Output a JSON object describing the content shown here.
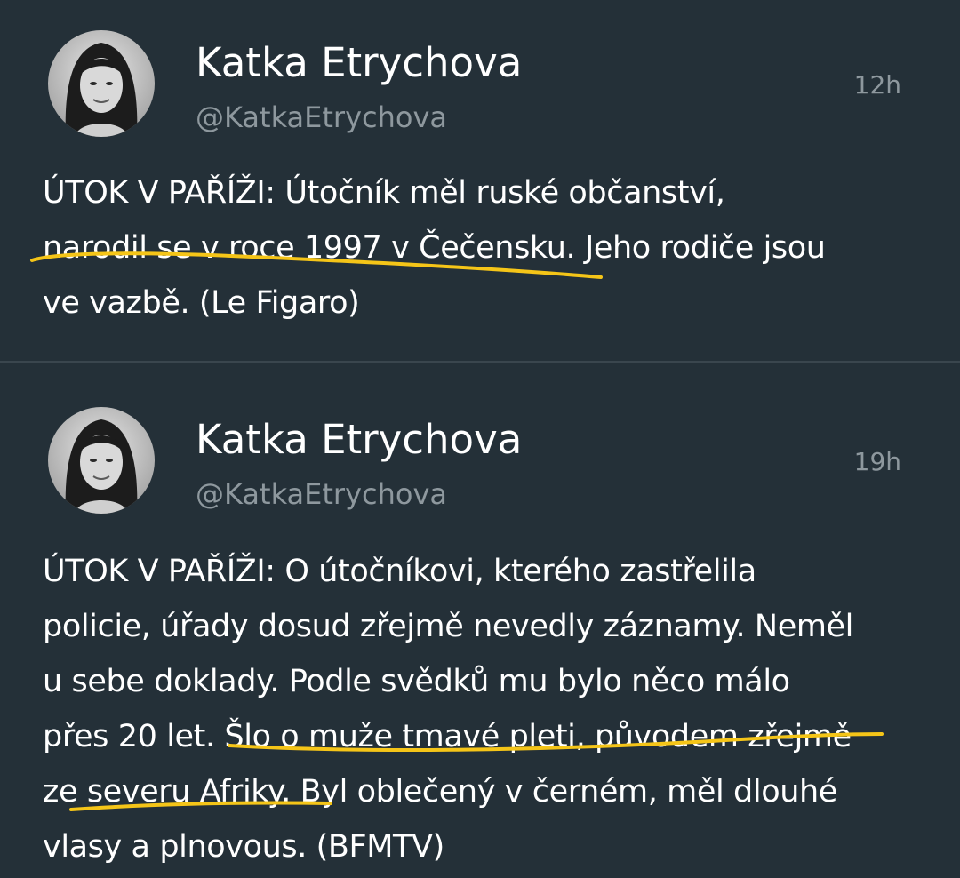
{
  "colors": {
    "background": "#243038",
    "name": "#ffffff",
    "meta": "#8e989e",
    "highlight": "#f5c518"
  },
  "tweets": [
    {
      "name": "Katka Etrychova",
      "handle": "@KatkaEtrychova",
      "time": "12h",
      "text_lines": [
        "ÚTOK V PAŘÍŽI: Útočník měl ruské občanství,",
        "narodil se v roce 1997 v Čečensku. Jeho rodiče jsou",
        "ve vazbě. (Le Figaro)"
      ]
    },
    {
      "name": "Katka Etrychova",
      "handle": "@KatkaEtrychova",
      "time": "19h",
      "text_lines": [
        "ÚTOK V PAŘÍŽI: O útočníkovi, kterého zastřelila",
        "policie, úřady dosud zřejmě nevedly záznamy. Neměl",
        "u sebe doklady. Podle svědků mu bylo něco málo",
        "přes 20 let. Šlo o muže tmavé pleti, původem zřejmě",
        "ze severu Afriky. Byl oblečený v černém, měl dlouhé",
        "vlasy a plnovous. (BFMTV)"
      ]
    }
  ]
}
